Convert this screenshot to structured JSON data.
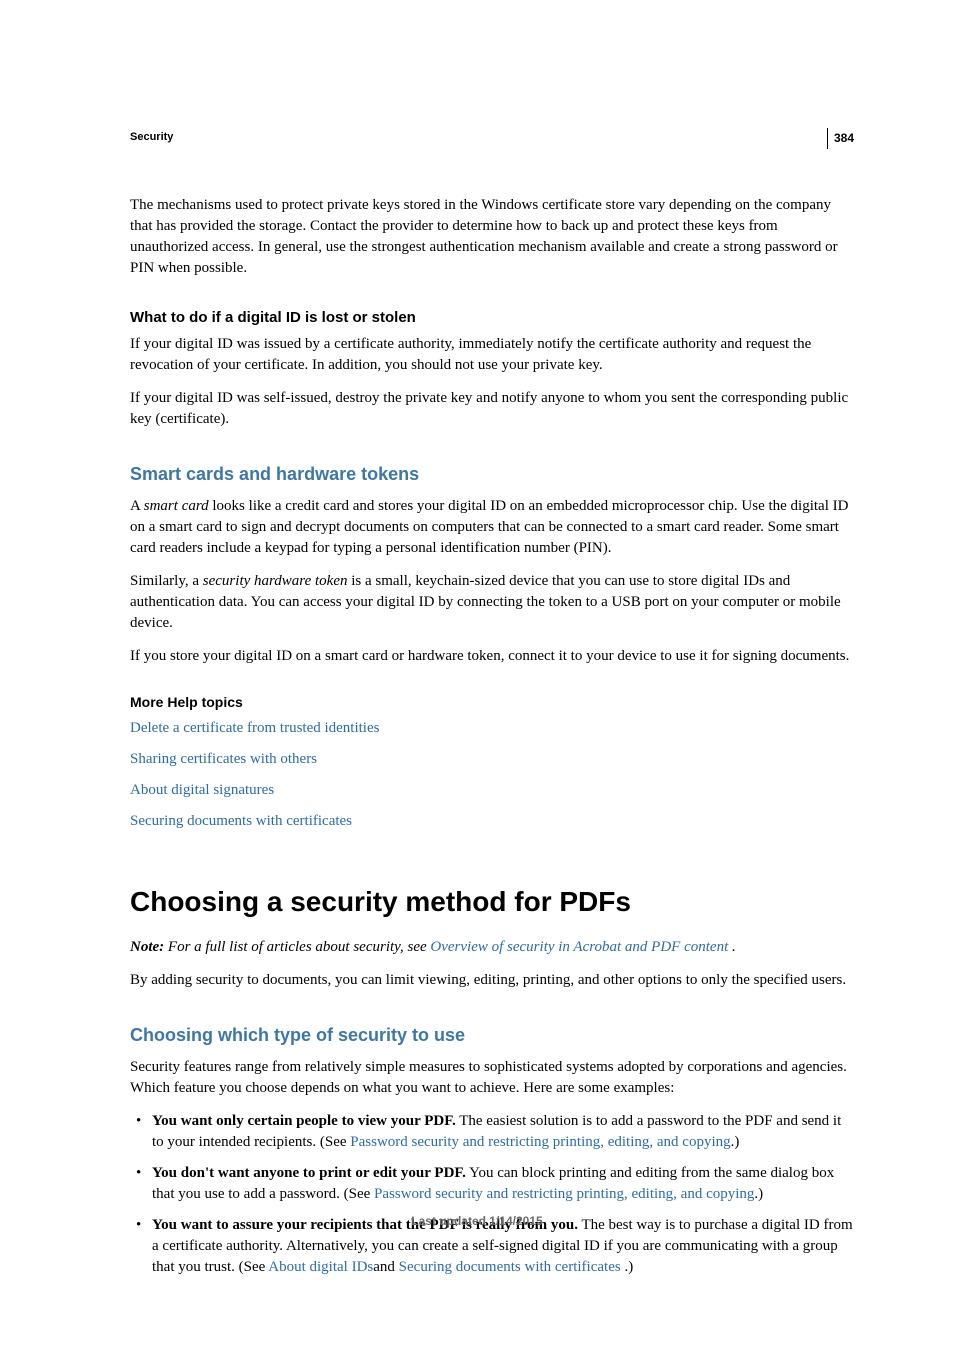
{
  "page_number": "384",
  "breadcrumb": "Security",
  "paragraphs": {
    "intro": "The mechanisms used to protect private keys stored in the Windows certificate store vary depending on the company that has provided the storage. Contact the provider to determine how to back up and protect these keys from unauthorized access. In general, use the strongest authentication mechanism available and create a strong password or PIN when possible."
  },
  "h3_lost": "What to do if a digital ID is lost or stolen",
  "lost_p1": "If your digital ID was issued by a certificate authority, immediately notify the certificate authority and request the revocation of your certificate. In addition, you should not use your private key.",
  "lost_p2": "If your digital ID was self-issued, destroy the private key and notify anyone to whom you sent the corresponding public key (certificate).",
  "h2_smart": "Smart cards and hardware tokens",
  "smart_p1_pre": "A ",
  "smart_p1_em": "smart card",
  "smart_p1_post": " looks like a credit card and stores your digital ID on an embedded microprocessor chip. Use the digital ID on a smart card to sign and decrypt documents on computers that can be connected to a smart card reader. Some smart card readers include a keypad for typing a personal identification number (PIN).",
  "smart_p2_pre": "Similarly, a ",
  "smart_p2_em": "security hardware token",
  "smart_p2_post": " is a small, keychain-sized device that you can use to store digital IDs and authentication data. You can access your digital ID by connecting the token to a USB port on your computer or mobile device.",
  "smart_p3": "If you store your digital ID on a smart card or hardware token, connect it to your device to use it for signing documents.",
  "h4_more": "More Help topics",
  "links": {
    "delete_cert": "Delete a certificate from trusted identities",
    "sharing": "Sharing certificates with others",
    "about_sig": "About digital signatures",
    "securing": "Securing documents with certificates"
  },
  "h1_choosing": "Choosing a security method for PDFs",
  "note_label": "Note:",
  "note_text_pre": " For a full list of articles about security, see ",
  "note_link": "Overview of security in Acrobat and PDF content",
  "note_text_post": " .",
  "adding_p": "By adding security to documents, you can limit viewing, editing, printing, and other options to only the specified users.",
  "h2_which": "Choosing which type of security to use",
  "which_p": "Security features range from relatively simple measures to sophisticated systems adopted by corporations and agencies. Which feature you choose depends on what you want to achieve. Here are some examples:",
  "bullets": {
    "b1_strong": "You want only certain people to view your PDF.",
    "b1_text": " The easiest solution is to add a password to the PDF and send it to your intended recipients. (See ",
    "b1_link": "Password security and restricting printing, editing, and copying",
    "b1_post": ".)",
    "b2_strong": "You don't want anyone to print or edit your PDF.",
    "b2_text": " You can block printing and editing from the same dialog box that you use to add a password. (See ",
    "b2_link": "Password security and restricting printing, editing, and copying",
    "b2_post": ".)",
    "b3_strong": "You want to assure your recipients that the PDF is really from you.",
    "b3_text": " The best way is to purchase a digital ID from a certificate authority. Alternatively, you can create a self-signed digital ID if you are communicating with a group that you trust. (See ",
    "b3_link1": "About digital IDs",
    "b3_mid": "and ",
    "b3_link2": "Securing documents with certificates",
    "b3_post": " .)"
  },
  "footer": "Last updated 1/14/2015"
}
